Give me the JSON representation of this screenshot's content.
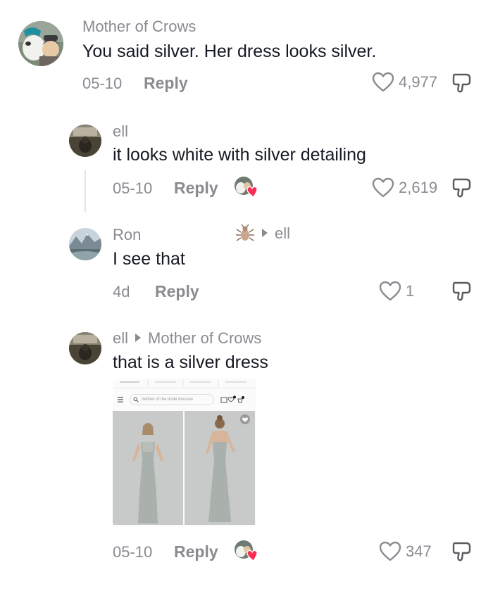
{
  "comments": [
    {
      "author": "Mother of Crows",
      "text": "You said silver. Her dress looks silver.",
      "date": "05-10",
      "reply_label": "Reply",
      "likes": "4,977"
    },
    {
      "author": "ell",
      "text": "it looks white with silver detailing",
      "date": "05-10",
      "reply_label": "Reply",
      "likes": "2,619"
    },
    {
      "author": "Ron",
      "reply_to": "ell",
      "text": "I see that",
      "date": "4d",
      "reply_label": "Reply",
      "likes": "1"
    },
    {
      "author": "ell",
      "reply_to": "Mother of Crows",
      "text": "that is a silver dress",
      "date": "05-10",
      "reply_label": "Reply",
      "likes": "347",
      "attachment": {
        "search_text": "mother of the bride dresses"
      }
    }
  ],
  "colors": {
    "muted": "#8a8b91",
    "text": "#161823",
    "heart_red": "#fe2c55"
  },
  "icons": [
    "heart-outline-icon",
    "dislike-icon",
    "menu-icon",
    "search-icon",
    "creator-liked-heart-icon"
  ]
}
